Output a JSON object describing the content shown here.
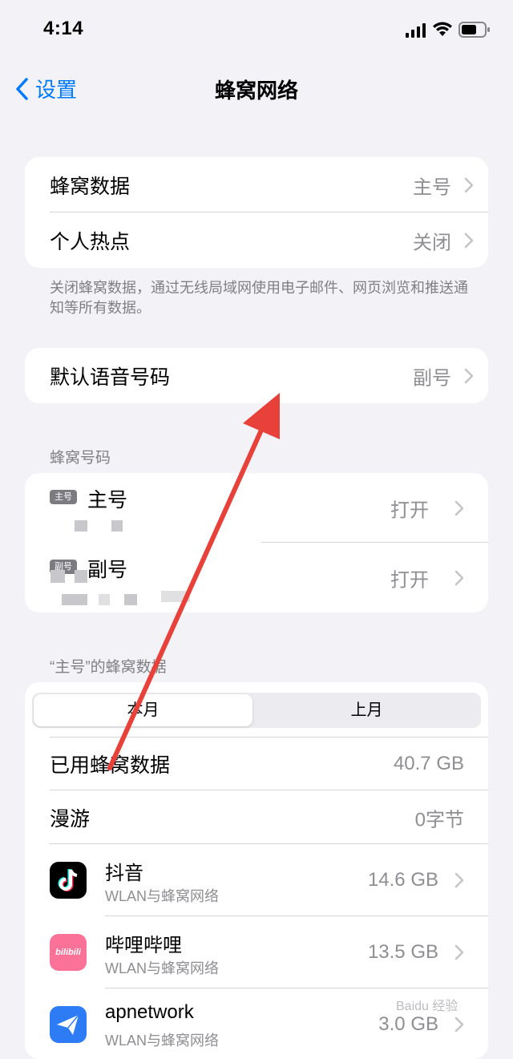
{
  "status_bar": {
    "time": "4:14"
  },
  "nav": {
    "back_label": "设置",
    "title": "蜂窝网络"
  },
  "group1": {
    "rows": [
      {
        "label": "蜂窝数据",
        "value": "主号"
      },
      {
        "label": "个人热点",
        "value": "关闭"
      }
    ],
    "footer": "关闭蜂窝数据，通过无线局域网使用电子邮件、网页浏览和推送通知等所有数据。"
  },
  "group2": {
    "label": "默认语音号码",
    "value": "副号"
  },
  "numbers": {
    "header": "蜂窝号码",
    "lines": [
      {
        "badge": "主号",
        "name": "主号",
        "status": "打开"
      },
      {
        "badge": "副号",
        "name": "副号",
        "status": "打开"
      }
    ]
  },
  "usage": {
    "header": "“主号”的蜂窝数据",
    "segments": [
      "本月",
      "上月"
    ],
    "rows": [
      {
        "label": "已用蜂窝数据",
        "value": "40.7 GB"
      },
      {
        "label": "漫游",
        "value": "0字节"
      }
    ],
    "apps": [
      {
        "name": "抖音",
        "sub": "WLAN与蜂窝网络",
        "value": "14.6 GB",
        "icon": "douyin-icon"
      },
      {
        "name": "哔哩哔哩",
        "sub": "WLAN与蜂窝网络",
        "value": "13.5 GB",
        "icon": "bilibili-icon",
        "icon_text": "bilibili"
      },
      {
        "name": "apnetwork",
        "sub": "WLAN与蜂窝网络",
        "value": "3.0 GB",
        "icon": "apnetwork-icon"
      }
    ]
  },
  "watermark": "Baidu 经验",
  "colors": {
    "accent": "#007aff",
    "arrow": "#e8413a",
    "background": "#f2f2f7"
  }
}
